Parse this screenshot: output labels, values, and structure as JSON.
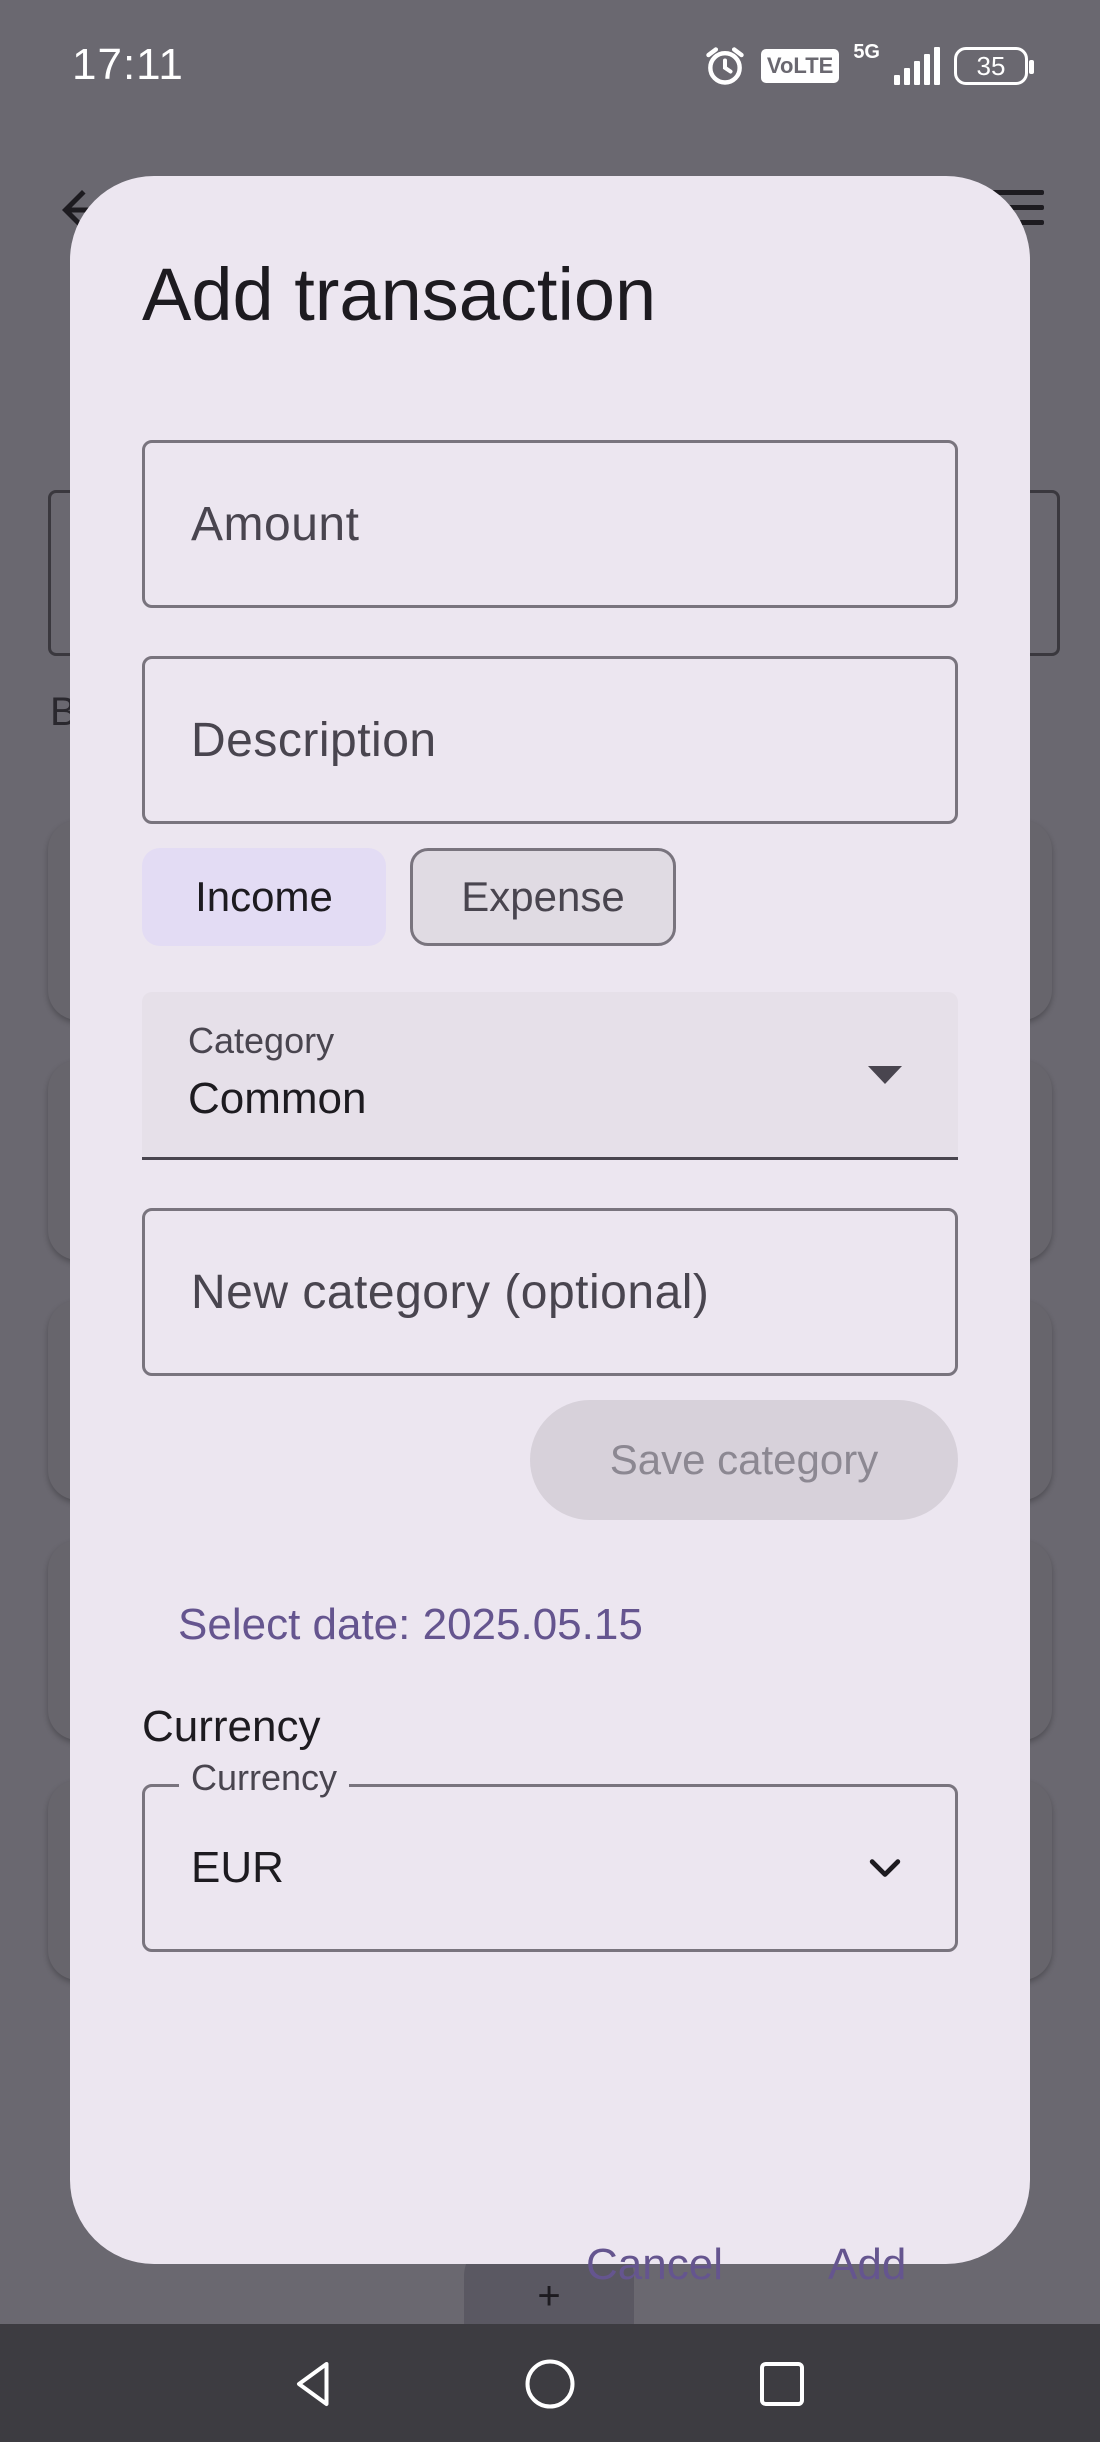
{
  "status_bar": {
    "time": "17:11",
    "volte_label": "VoLTE",
    "network_label": "5G",
    "battery_level": "35",
    "icons": [
      "alarm-icon",
      "volte-icon",
      "signal-icon",
      "battery-icon"
    ]
  },
  "background": {
    "partial_text": "B",
    "fab_label": "+"
  },
  "dialog": {
    "title": "Add transaction",
    "amount_placeholder": "Amount",
    "description_placeholder": "Description",
    "type_chips": [
      {
        "label": "Income",
        "selected": true
      },
      {
        "label": "Expense",
        "selected": false
      }
    ],
    "category": {
      "label": "Category",
      "value": "Common"
    },
    "new_category_placeholder": "New category (optional)",
    "save_category_label": "Save category",
    "select_date_label": "Select date: 2025.05.15",
    "currency_heading": "Currency",
    "currency": {
      "label": "Currency",
      "value": "EUR"
    },
    "cancel_label": "Cancel",
    "add_label": "Add"
  },
  "colors": {
    "scrim": "#6a6870",
    "dialog_surface": "#ece6f0",
    "primary": "#65558f",
    "selected_chip": "#e3dcf4",
    "outline": "#79747e"
  },
  "nav_bar": {
    "icons": [
      "back-triangle-icon",
      "home-circle-icon",
      "recents-square-icon"
    ]
  }
}
